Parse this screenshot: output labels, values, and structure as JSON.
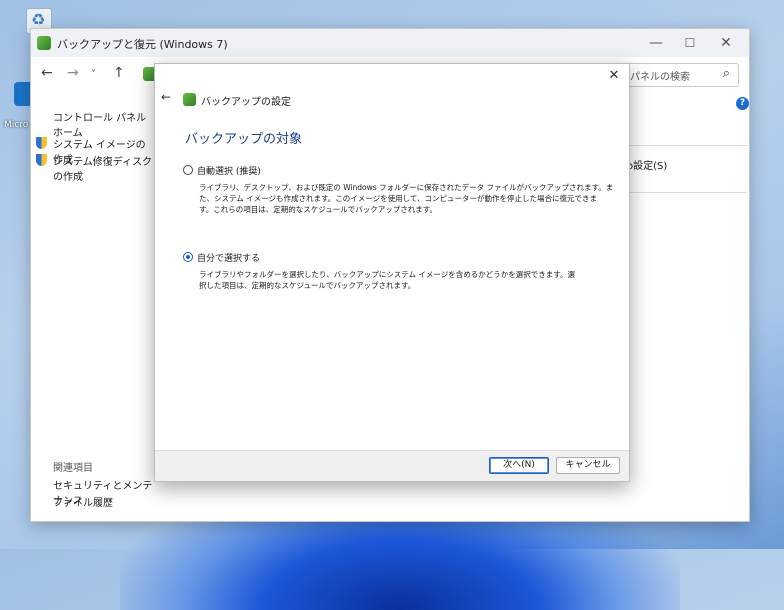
{
  "window": {
    "title": "バックアップと復元 (Windows 7)",
    "min": "—",
    "max": "☐",
    "close": "✕"
  },
  "nav": {
    "back": "←",
    "forward": "→",
    "down": "˅",
    "up": "↑",
    "search_placeholder": "パネルの検索",
    "search_icon": "⌕"
  },
  "sidebar": {
    "home": "コントロール パネル ホーム",
    "links": [
      "システム イメージの作成",
      "システム修復ディスクの作成"
    ],
    "related_heading": "関連項目",
    "related_links": [
      "セキュリティとメンテナンス",
      "ファイル履歴"
    ]
  },
  "behind": {
    "settings_link": "o設定(S)",
    "help": "?"
  },
  "dialog": {
    "close": "✕",
    "back": "←",
    "title": "バックアップの設定",
    "heading": "バックアップの対象",
    "options": [
      {
        "label": "自動選択 (推奨)",
        "checked": false,
        "desc_lines": [
          "ライブラリ、デスクトップ、および既定の Windows フォルダーに保存されたデータ ファイルがバックアップされます。ま",
          "た、システム イメージも作成されます。このイメージを使用して、コンピューターが動作を停止した場合に復元できま",
          "す。これらの項目は、定期的なスケジュールでバックアップされます。"
        ]
      },
      {
        "label": "自分で選択する",
        "checked": true,
        "desc_lines": [
          "ライブラリやフォルダーを選択したり、バックアップにシステム イメージを含めるかどうかを選択できます。選",
          "択した項目は、定期的なスケジュールでバックアップされます。"
        ]
      }
    ],
    "next_button": "次へ(N)",
    "cancel_button": "キャンセル"
  },
  "desktop": {
    "edge_label": "Micro"
  }
}
